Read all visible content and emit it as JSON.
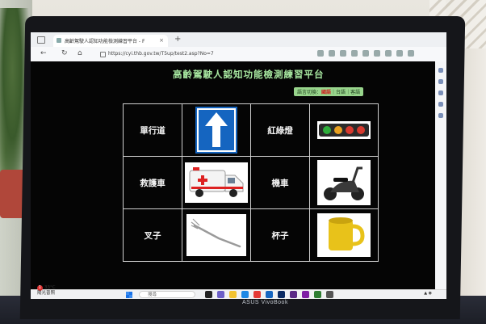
{
  "browser": {
    "tab_title": "高齡駕駛人認知功能檢測練習平台 - F",
    "tab_close": "×",
    "new_tab": "+",
    "url": "https://cyi.thb.gov.tw/T5up/test2.asp?No=7"
  },
  "page": {
    "title": "高齡駕駛人認知功能檢測練習平台",
    "language": {
      "prefix": "語言切換：",
      "options": [
        "國語",
        "台語",
        "客語"
      ],
      "separator": "｜",
      "active": "國語"
    },
    "rows": [
      {
        "left_label": "單行道",
        "left_icon": "one-way-sign",
        "right_label": "紅綠燈",
        "right_icon": "traffic-light"
      },
      {
        "left_label": "救護車",
        "left_icon": "ambulance",
        "right_label": "機車",
        "right_icon": "scooter"
      },
      {
        "left_label": "叉子",
        "left_icon": "fork",
        "right_label": "杯子",
        "right_icon": "mug"
      }
    ]
  },
  "taskbar": {
    "temperature": "33°C",
    "weather": "陽光普照",
    "notification_count": "1",
    "search_placeholder": "搜尋"
  },
  "laptop_brand": "ASUS VivoBook",
  "colors": {
    "title": "#a7e7a0",
    "page_background": "#050505",
    "language_bar": "#98d58c",
    "active_language": "#d02020",
    "sign_blue": "#1565c0",
    "mug_yellow": "#e8c21a"
  }
}
